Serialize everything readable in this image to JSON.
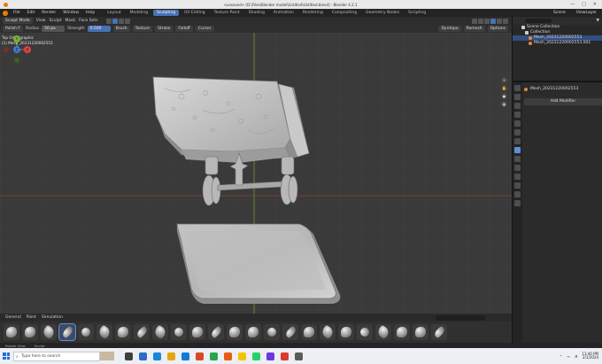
{
  "window": {
    "title": "<unsaved> [D:\\Files\\Blender model\\Untitled\\Untitled.blend] - Blender 4.2.1",
    "controls": [
      "—",
      "□",
      "✕"
    ]
  },
  "menu": {
    "items": [
      "File",
      "Edit",
      "Render",
      "Window",
      "Help"
    ],
    "workspace_tabs": [
      "Layout",
      "Modeling",
      "Sculpting",
      "UV Editing",
      "Texture Paint",
      "Shading",
      "Animation",
      "Rendering",
      "Compositing",
      "Geometry Nodes",
      "Scripting"
    ],
    "active_tab": "Sculpting",
    "scene": "Scene",
    "view_layer": "ViewLayer"
  },
  "header": {
    "mode": "Sculpt Mode",
    "menus": [
      "View",
      "Sculpt",
      "Mask",
      "Face Sets"
    ],
    "right_items": [
      "Dyntopo",
      "Remesh",
      "Options"
    ]
  },
  "tool_settings": {
    "brush": "Polish F",
    "radius_label": "Radius",
    "radius_value": "50 px",
    "strength_label": "Strength",
    "strength_value": "0.500",
    "dropdowns": [
      "Brush",
      "Texture",
      "Stroke",
      "Falloff",
      "Cursor"
    ]
  },
  "viewport": {
    "view_name": "Top Orthographic",
    "object_info": "(1) Mesh_20231220002553",
    "gizmo_axes": {
      "x": "X",
      "y": "Y",
      "z": "Z"
    },
    "colors": {
      "background": "#3a3a3a",
      "grid": "#444444",
      "axis_green": "#6e9a2c",
      "axis_red": "#9b3b3b",
      "mesh": "#cfcfcf"
    }
  },
  "outliner": {
    "title": "Scene Collection",
    "rows": [
      "Scene Collection",
      "Collection",
      "Mesh_20231220002553",
      "Mesh_20231220002553.001"
    ]
  },
  "properties": {
    "object_name": "Mesh_20231220002553",
    "add_modifier": "Add Modifier"
  },
  "asset_shelf": {
    "tabs": [
      "General",
      "Paint",
      "Simulation"
    ],
    "search_placeholder": "",
    "brush_count": 24,
    "selected_index": 3
  },
  "status_bar": {
    "items": [
      "Rotate View",
      "Sculpt"
    ]
  },
  "taskbar": {
    "search_placeholder": "Type here to search",
    "clock_time": "11:40 PM",
    "clock_date": "2/1/2024",
    "app_colors": [
      "#3f3f3f",
      "#2b6cc4",
      "#1787d6",
      "#e5a614",
      "#0f7bd6",
      "#d64b26",
      "#2aa44a",
      "#e85b12",
      "#f5c400",
      "#25d366",
      "#6a3ae0",
      "#da3b2c",
      "#5a5a5a"
    ]
  }
}
